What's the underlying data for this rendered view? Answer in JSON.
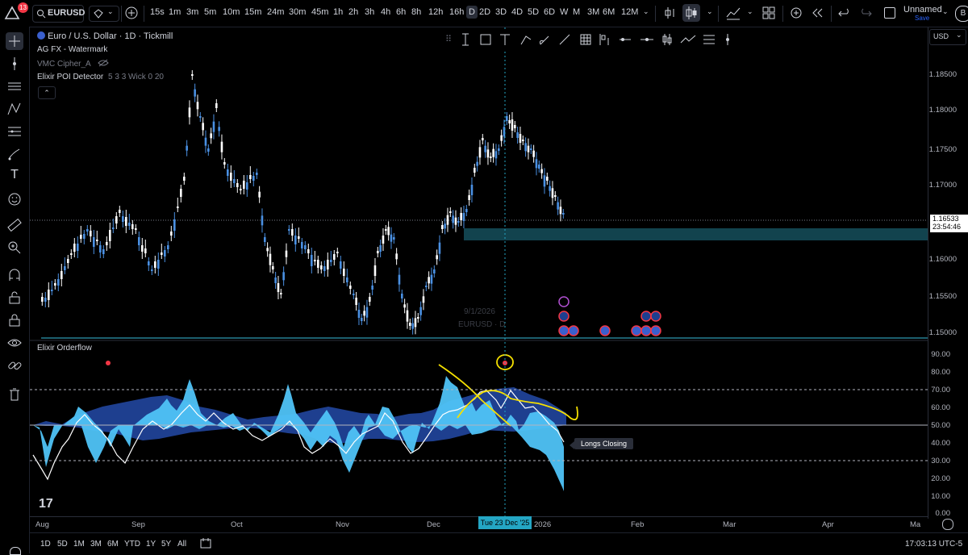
{
  "colors": {
    "background": "#000000",
    "candle_up": "#4a90e2",
    "candle_down": "#ffffff",
    "poi_zone": "#12434e",
    "cursor_line": "#24a6c4",
    "osc_light": "#4fc3f7",
    "osc_dark": "#1e3f8f",
    "annotation": "#f5e000",
    "alert_badge": "#f23645"
  },
  "topbar": {
    "notification_count": "13",
    "symbol": "EURUSD",
    "intervals": [
      "15s",
      "1m",
      "3m",
      "5m",
      "10m",
      "15m",
      "24m",
      "30m",
      "45m",
      "1h",
      "2h",
      "3h",
      "4h",
      "6h",
      "8h",
      "12h",
      "16h",
      "D",
      "2D",
      "3D",
      "4D",
      "5D",
      "6D",
      "W",
      "M",
      "3M",
      "6M",
      "12M"
    ],
    "active_interval": "D",
    "layout_name": "Unnamed",
    "save_label": "Save"
  },
  "legend": {
    "title": "Euro / U.S. Dollar · 1D · Tickmill",
    "line2": "AG FX - Watermark",
    "line3": "VMC Cipher_A",
    "line4_name": "Elixir POI Detector",
    "line4_params": "5 3 3 Wick 0 20",
    "osc_title": "Elixir Orderflow"
  },
  "price_scale": {
    "currency": "USD",
    "labels": [
      "1.18500",
      "1.18000",
      "1.17500",
      "1.17000",
      "1.16000",
      "1.15500",
      "1.15000"
    ],
    "last_price": "1.16533",
    "countdown": "23:54:46"
  },
  "osc_scale": {
    "labels": [
      "90.00",
      "80.00",
      "70.00",
      "60.00",
      "50.00",
      "40.00",
      "30.00",
      "20.00",
      "10.00",
      "0.00"
    ]
  },
  "time_axis": {
    "labels": [
      "Aug",
      "Sep",
      "Oct",
      "Nov",
      "Dec",
      "2026",
      "Feb",
      "Mar",
      "Apr",
      "Ma"
    ],
    "crosshair": "Tue 23 Dec '25"
  },
  "watermark": {
    "date": "9/1/2026",
    "symbol": "EURUSD · D"
  },
  "oscillator": {
    "longs_closing_label": "Longs Closing"
  },
  "bottombar": {
    "ranges": [
      "1D",
      "5D",
      "1M",
      "3M",
      "6M",
      "YTD",
      "1Y",
      "5Y",
      "All"
    ],
    "clock": "17:03:13 UTC-5"
  },
  "icons": [
    "tradingview-logo-icon",
    "search-icon",
    "add-icon",
    "bar-style-icon",
    "indicators-icon",
    "layout-icon",
    "alert-icon",
    "replay-icon",
    "undo-icon",
    "redo-icon",
    "crosshair-icon",
    "trendline-icon",
    "fib-icon",
    "pattern-icon",
    "brush-icon",
    "text-icon",
    "emoji-icon",
    "ruler-icon",
    "zoom-icon",
    "magnet-icon",
    "lock-icon",
    "eye-icon",
    "link-icon",
    "trash-icon"
  ]
}
